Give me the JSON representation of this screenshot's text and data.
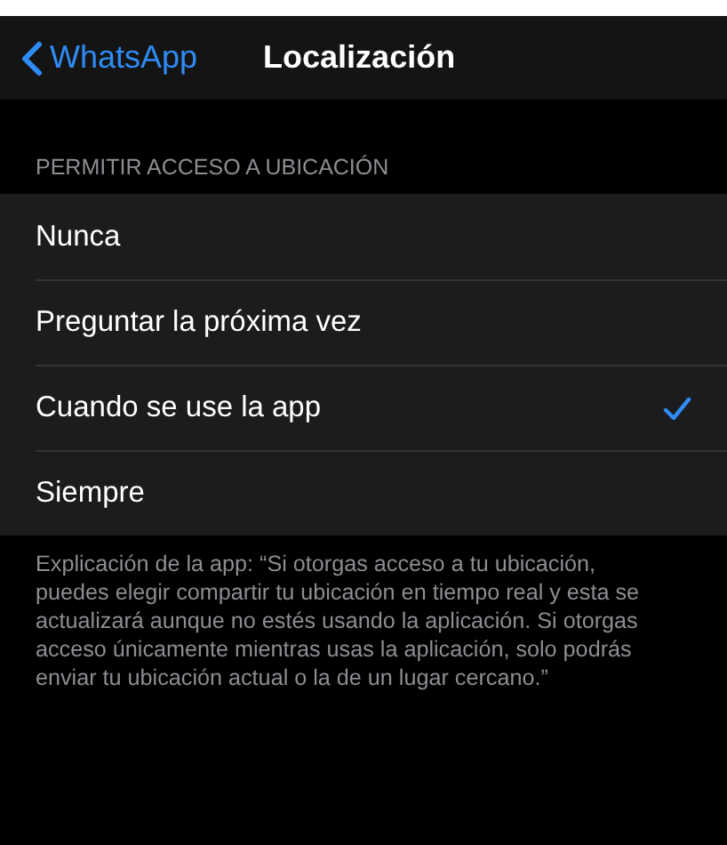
{
  "nav": {
    "back": "WhatsApp",
    "title": "Localización"
  },
  "section": {
    "header": "PERMITIR ACCESO A UBICACIÓN",
    "options": [
      {
        "label": "Nunca",
        "selected": false
      },
      {
        "label": "Preguntar la próxima vez",
        "selected": false
      },
      {
        "label": "Cuando se use la app",
        "selected": true
      },
      {
        "label": "Siempre",
        "selected": false
      }
    ],
    "footer": "Explicación de la app: “Si otorgas acceso a tu ubicación, puedes elegir compartir tu ubicación en tiempo real y esta se actualizará aunque no estés usando la aplicación. Si otorgas acceso únicamente mientras usas la aplicación, solo podrás enviar tu ubicación actual o la de un lugar cercano.”"
  }
}
